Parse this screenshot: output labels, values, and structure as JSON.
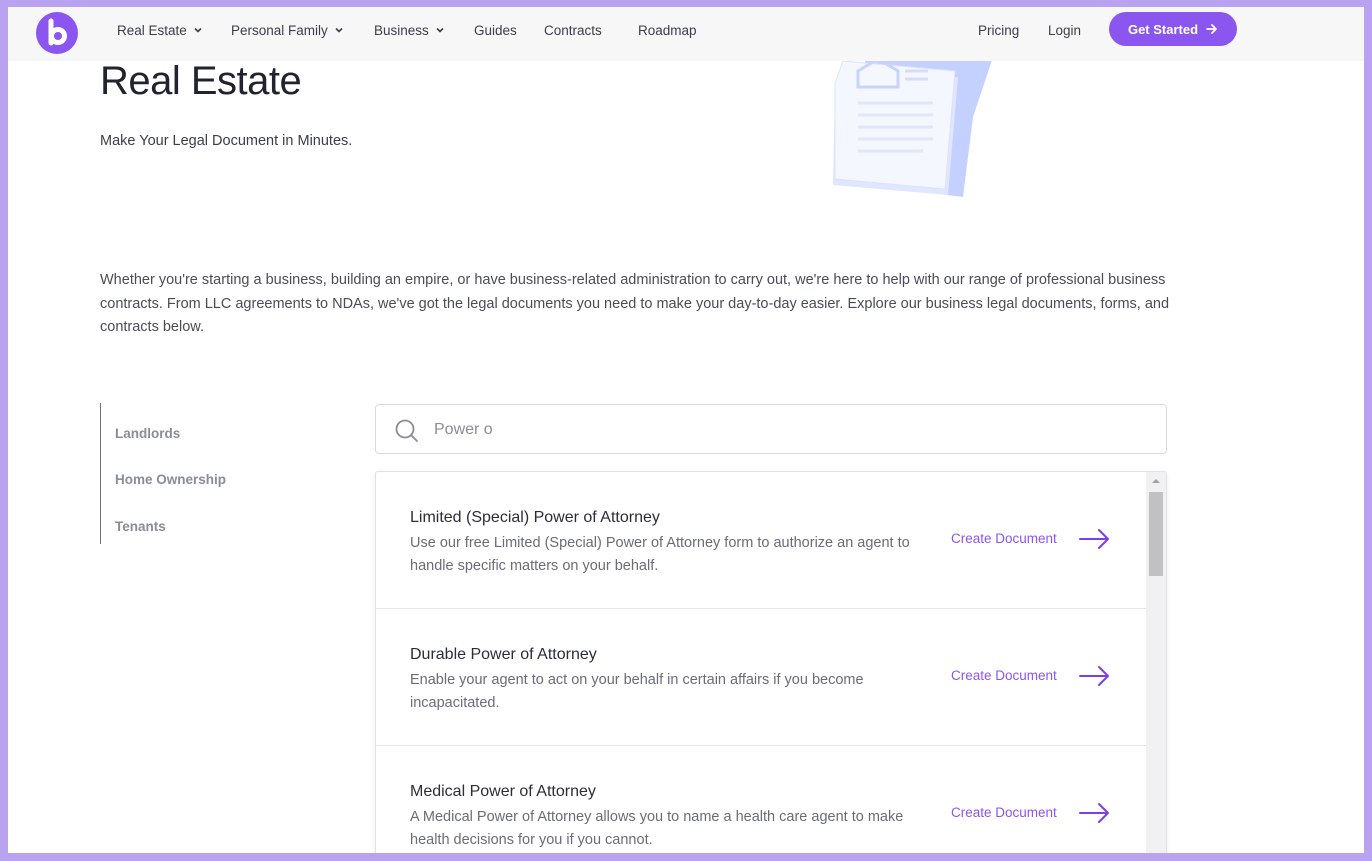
{
  "nav": {
    "logo_letter": "b",
    "items": [
      {
        "label": "Real Estate",
        "dropdown": true
      },
      {
        "label": "Personal Family",
        "dropdown": true
      },
      {
        "label": "Business",
        "dropdown": true
      },
      {
        "label": "Guides",
        "dropdown": false
      },
      {
        "label": "Contracts",
        "dropdown": false
      },
      {
        "label": "Roadmap",
        "dropdown": false
      }
    ],
    "pricing": "Pricing",
    "login": "Login",
    "cta": "Get Started"
  },
  "hero": {
    "title": "Real Estate",
    "subtitle": "Make Your Legal Document in Minutes."
  },
  "intro": "Whether you're starting a business, building an empire, or have business-related administration to carry out, we're here to help with our range of professional business contracts. From LLC agreements to NDAs, we've got the legal documents you need to make your day-to-day easier. Explore our business legal documents, forms, and contracts below.",
  "sidebar": {
    "items": [
      {
        "label": "Landlords"
      },
      {
        "label": "Home Ownership"
      },
      {
        "label": "Tenants"
      }
    ]
  },
  "search": {
    "value": "Power o"
  },
  "documents": [
    {
      "title": "Limited (Special) Power of Attorney",
      "description": "Use our free Limited (Special) Power of Attorney form to authorize an agent to handle specific matters on your behalf.",
      "cta": "Create Document"
    },
    {
      "title": "Durable Power of Attorney",
      "description": "Enable your agent to act on your behalf in certain affairs if you become incapacitated.",
      "cta": "Create Document"
    },
    {
      "title": "Medical Power of Attorney",
      "description": "A Medical Power of Attorney allows you to name a health care agent to make health decisions for you if you cannot.",
      "cta": "Create Document"
    }
  ],
  "colors": {
    "accent": "#8b55f0",
    "frame": "#b9a2f0"
  }
}
